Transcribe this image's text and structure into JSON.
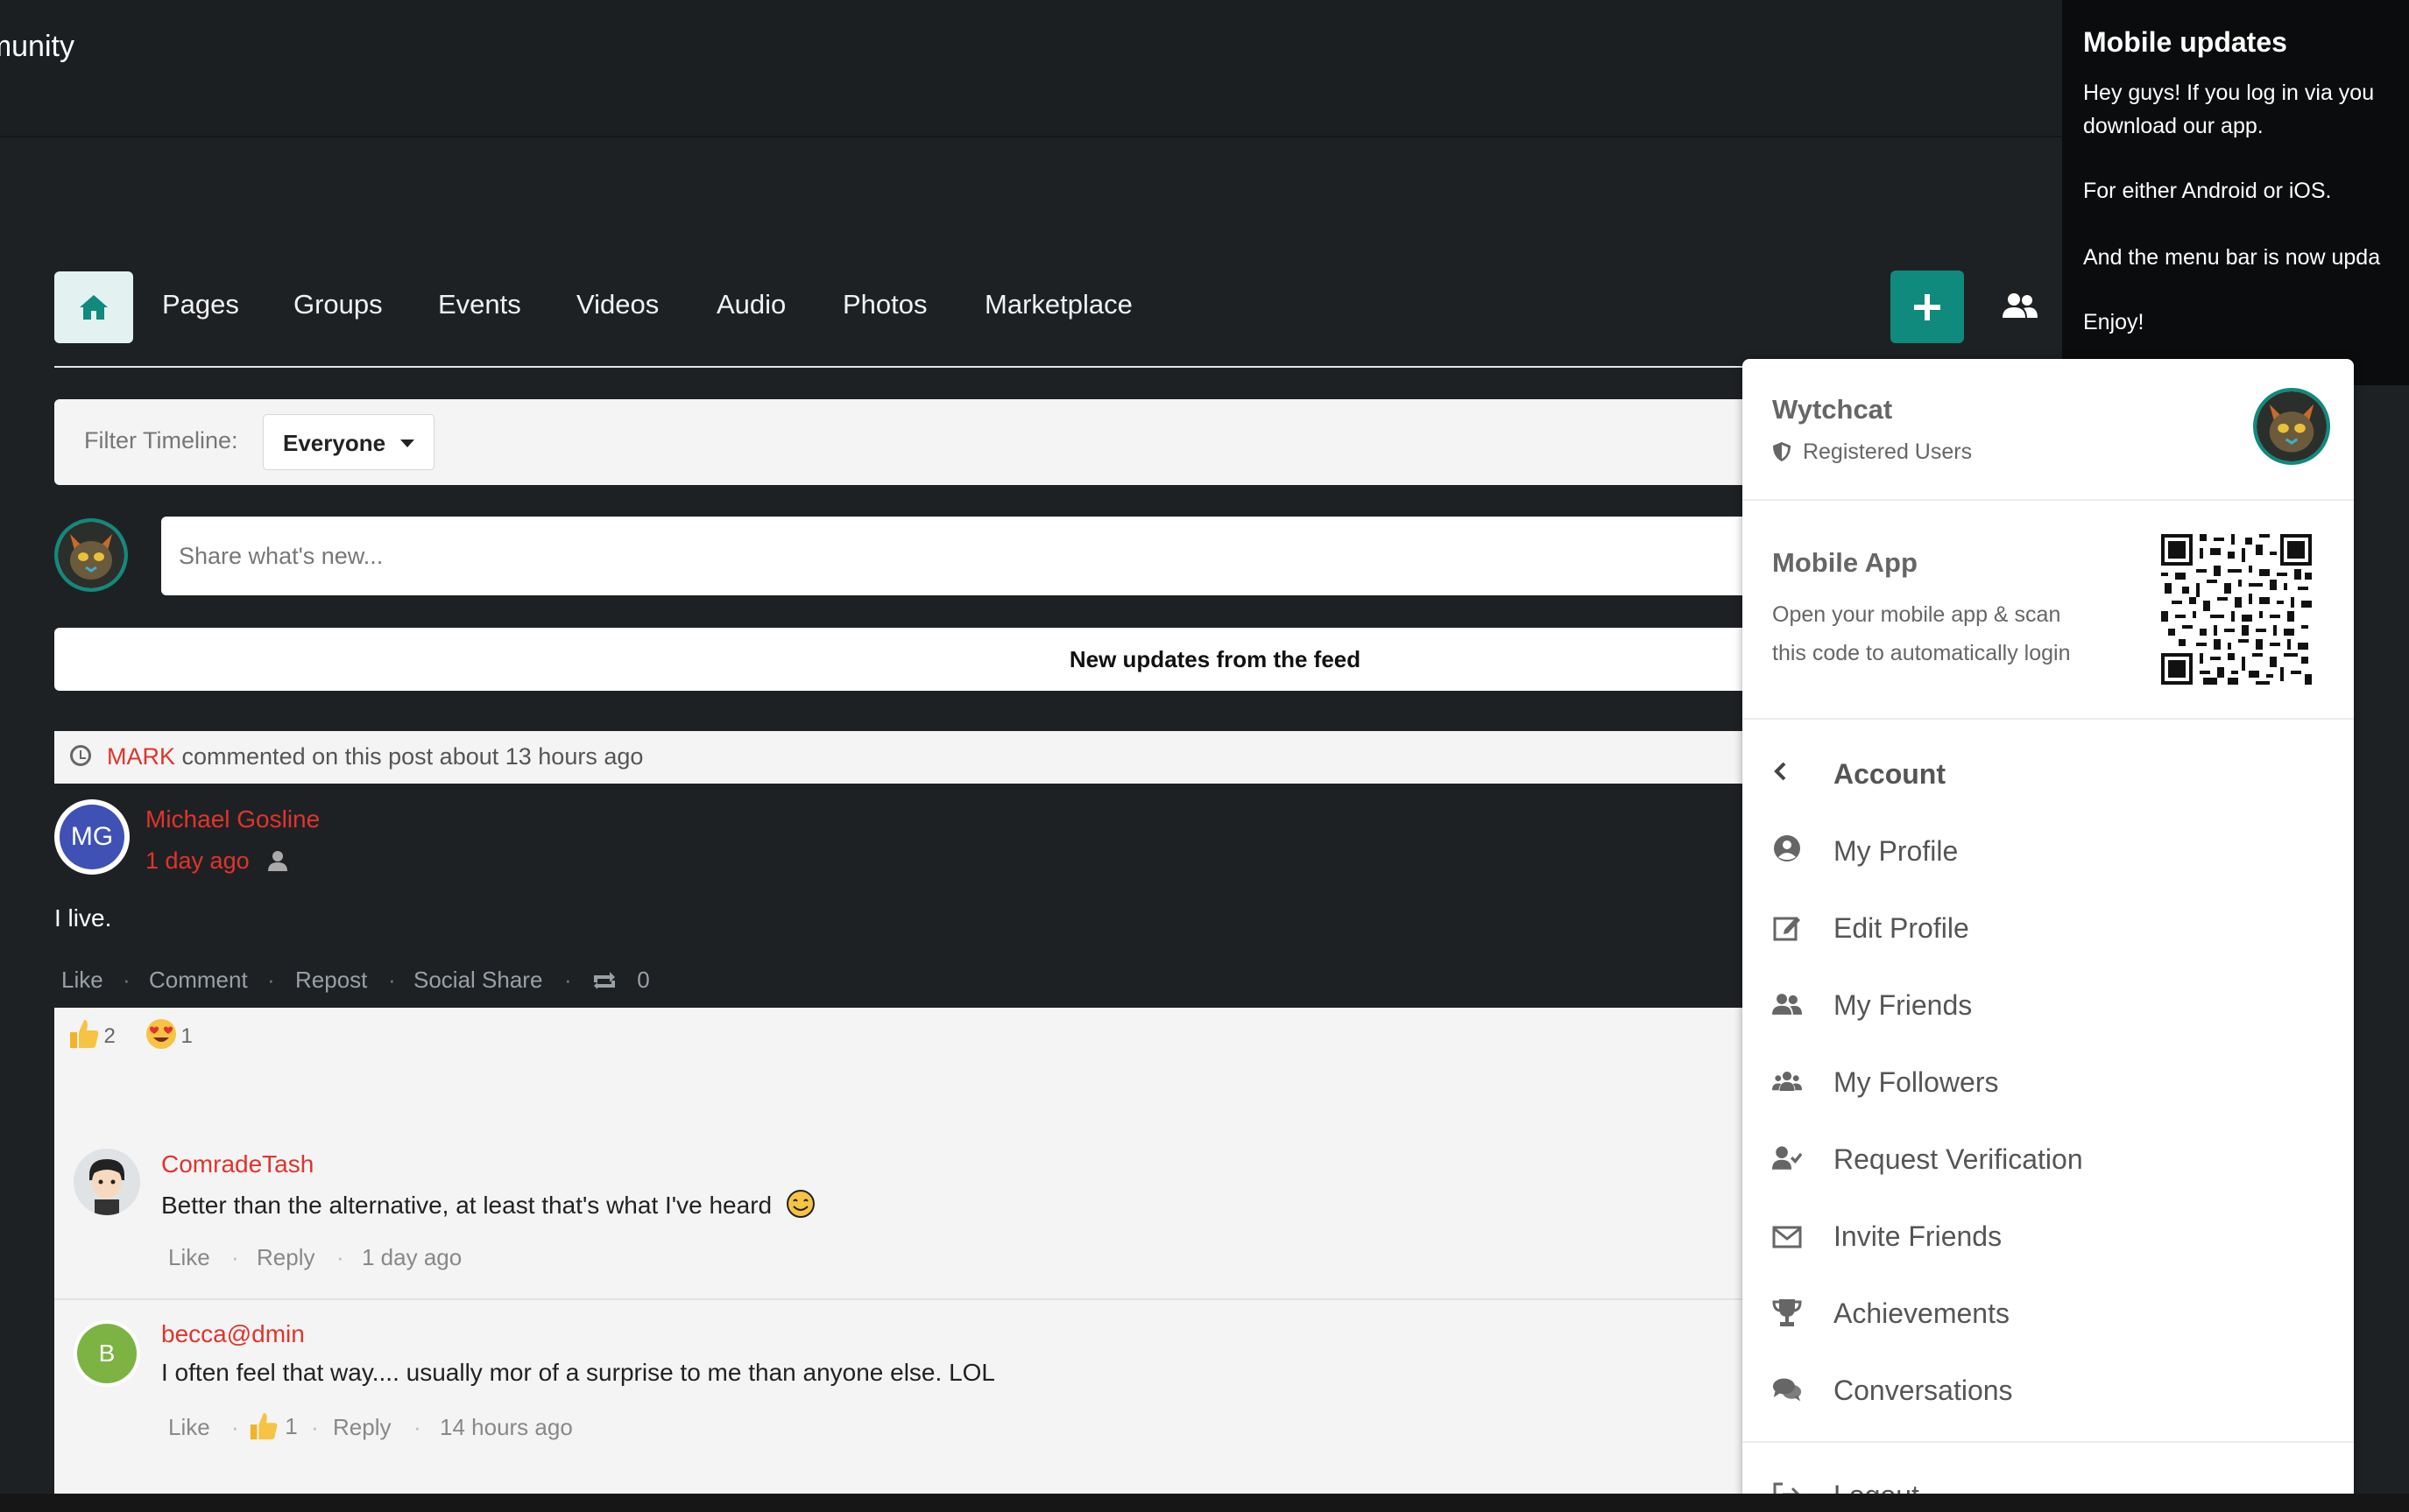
{
  "header": {
    "title": "Community"
  },
  "nav": {
    "items": [
      {
        "label": "Pages"
      },
      {
        "label": "Groups"
      },
      {
        "label": "Events"
      },
      {
        "label": "Videos"
      },
      {
        "label": "Audio"
      },
      {
        "label": "Photos"
      },
      {
        "label": "Marketplace"
      }
    ],
    "home_icon": "home-icon",
    "create_icon": "plus-icon",
    "accent": "#0f8a7c"
  },
  "filter": {
    "label": "Filter Timeline:",
    "selected": "Everyone"
  },
  "composer": {
    "placeholder": "Share what's new..."
  },
  "feed": {
    "new_updates": "New updates from the feed"
  },
  "activity": {
    "user": "MARK",
    "text": "commented on this post about 13 hours ago"
  },
  "post": {
    "avatar_initials": "MG",
    "author": "Michael Gosline",
    "time": "1 day ago",
    "text": "I live.",
    "actions": [
      "Like",
      "Comment",
      "Repost",
      "Social Share"
    ],
    "repost_count": "0",
    "reactions": [
      {
        "icon": "thumbs-up",
        "count": "2"
      },
      {
        "icon": "heart-eyes",
        "count": "1"
      }
    ]
  },
  "comments": [
    {
      "author": "ComradeTash",
      "text": "Better than the alternative, at least that's what I've heard",
      "like": "Like",
      "reply": "Reply",
      "time": "1 day ago"
    },
    {
      "avatar_initial": "B",
      "author": "becca@dmin",
      "text": "I often feel that way.... usually mor of a surprise to me than anyone else. LOL",
      "like": "Like",
      "like_count": "1",
      "reply": "Reply",
      "time": "14 hours ago"
    }
  ],
  "menu": {
    "user": {
      "name": "Wytchcat",
      "role": "Registered Users"
    },
    "mobile_app": {
      "title": "Mobile App",
      "desc_line1": "Open your mobile app & scan",
      "desc_line2": "this code to automatically login"
    },
    "account_label": "Account",
    "items": [
      {
        "label": "My Profile",
        "icon": "user-circle-icon"
      },
      {
        "label": "Edit Profile",
        "icon": "edit-icon"
      },
      {
        "label": "My Friends",
        "icon": "friends-icon"
      },
      {
        "label": "My Followers",
        "icon": "followers-icon"
      },
      {
        "label": "Request Verification",
        "icon": "user-check-icon"
      },
      {
        "label": "Invite Friends",
        "icon": "envelope-icon"
      },
      {
        "label": "Achievements",
        "icon": "trophy-icon"
      },
      {
        "label": "Conversations",
        "icon": "chat-icon"
      }
    ],
    "logout": "Logout"
  },
  "popup": {
    "title": "Mobile updates",
    "lines": [
      "Hey guys! If you log in via you",
      "download our app.",
      "For either Android or iOS.",
      "And the menu bar is now upda",
      "Enjoy!"
    ]
  }
}
